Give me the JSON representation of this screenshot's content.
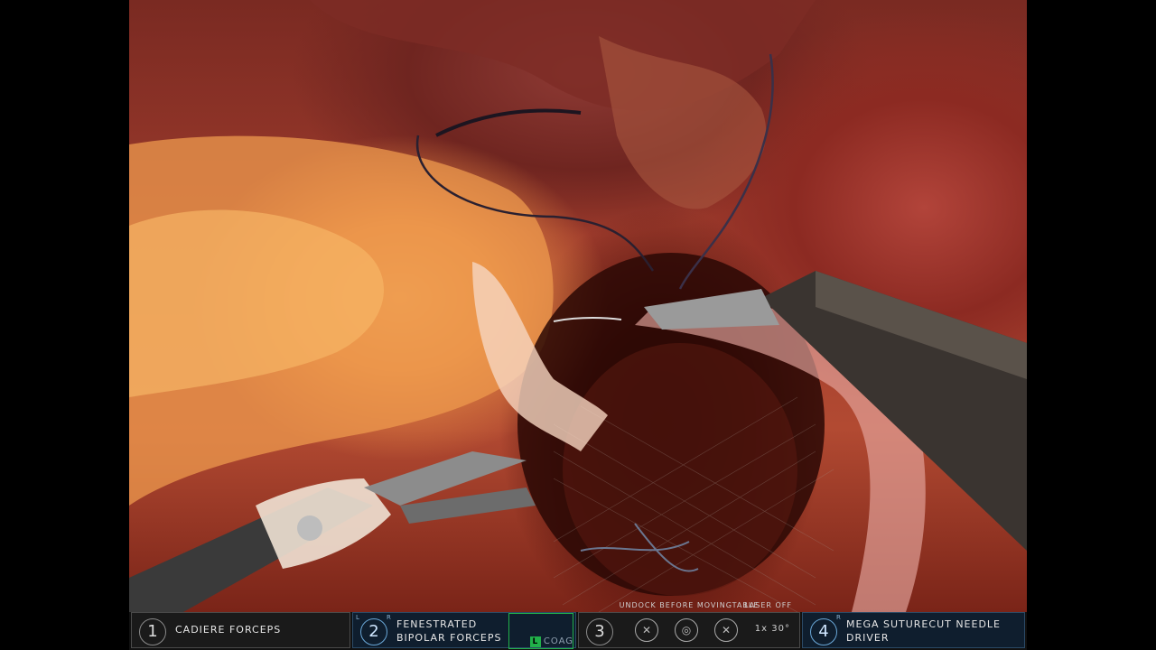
{
  "hud": {
    "arm1": {
      "number": "1",
      "tool": "CADIERE FORCEPS"
    },
    "arm2": {
      "number": "2",
      "tool_line1": "FENESTRATED",
      "tool_line2": "BIPOLAR FORCEPS",
      "corner_left": "L",
      "corner_right": "R",
      "energy_mode": "COAG",
      "energy_side": "L"
    },
    "camera": {
      "number": "3",
      "notice": "UNDOCK BEFORE MOVINGTABLE",
      "laser": "LASER OFF",
      "zoom": "1x",
      "angle": "30°"
    },
    "arm4": {
      "number": "4",
      "corner": "R",
      "tool_line1": "MEGA SUTURECUT NEEDLE",
      "tool_line2": "DRIVER"
    }
  },
  "colors": {
    "active_arm": "#0f1e2e",
    "energy_green": "#21b04a",
    "tissue_red": "#9e3b2c"
  }
}
